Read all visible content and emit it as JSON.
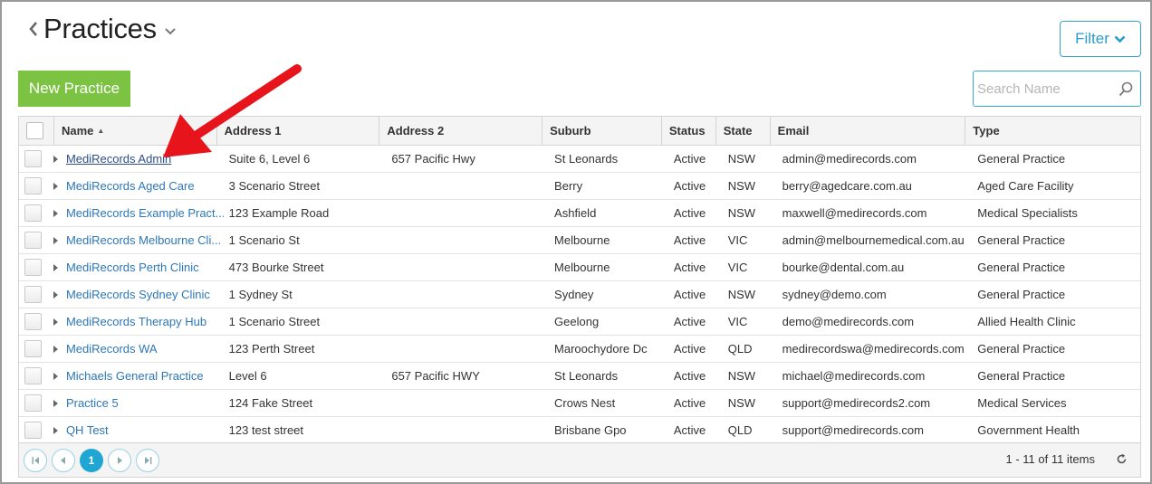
{
  "header": {
    "title": "Practices"
  },
  "toolbar": {
    "filter_label": "Filter",
    "new_practice_label": "New Practice",
    "search_placeholder": "Search Name",
    "search_value": ""
  },
  "grid": {
    "columns": {
      "name": "Name",
      "address1": "Address 1",
      "address2": "Address 2",
      "suburb": "Suburb",
      "status": "Status",
      "state": "State",
      "email": "Email",
      "type": "Type"
    },
    "rows": [
      {
        "name": "MediRecords Admin",
        "address1": "Suite 6, Level 6",
        "address2": "657 Pacific Hwy",
        "suburb": "St Leonards",
        "status": "Active",
        "state": "NSW",
        "email": "admin@medirecords.com",
        "type": "General Practice"
      },
      {
        "name": "MediRecords Aged Care",
        "address1": "3 Scenario Street",
        "address2": "",
        "suburb": "Berry",
        "status": "Active",
        "state": "NSW",
        "email": "berry@agedcare.com.au",
        "type": "Aged Care Facility"
      },
      {
        "name": "MediRecords Example Pract...",
        "address1": "123 Example Road",
        "address2": "",
        "suburb": "Ashfield",
        "status": "Active",
        "state": "NSW",
        "email": "maxwell@medirecords.com",
        "type": "Medical Specialists"
      },
      {
        "name": "MediRecords Melbourne Cli...",
        "address1": "1 Scenario St",
        "address2": "",
        "suburb": "Melbourne",
        "status": "Active",
        "state": "VIC",
        "email": "admin@melbournemedical.com.au",
        "type": "General Practice"
      },
      {
        "name": "MediRecords Perth Clinic",
        "address1": "473 Bourke Street",
        "address2": "",
        "suburb": "Melbourne",
        "status": "Active",
        "state": "VIC",
        "email": "bourke@dental.com.au",
        "type": "General Practice"
      },
      {
        "name": "MediRecords Sydney Clinic",
        "address1": "1 Sydney St",
        "address2": "",
        "suburb": "Sydney",
        "status": "Active",
        "state": "NSW",
        "email": "sydney@demo.com",
        "type": "General Practice"
      },
      {
        "name": "MediRecords Therapy Hub",
        "address1": "1 Scenario Street",
        "address2": "",
        "suburb": "Geelong",
        "status": "Active",
        "state": "VIC",
        "email": "demo@medirecords.com",
        "type": "Allied Health Clinic"
      },
      {
        "name": "MediRecords WA",
        "address1": "123 Perth Street",
        "address2": "",
        "suburb": "Maroochydore Dc",
        "status": "Active",
        "state": "QLD",
        "email": "medirecordswa@medirecords.com",
        "type": "General Practice"
      },
      {
        "name": "Michaels General Practice",
        "address1": "Level 6",
        "address2": "657 Pacific HWY",
        "suburb": "St Leonards",
        "status": "Active",
        "state": "NSW",
        "email": "michael@medirecords.com",
        "type": "General Practice"
      },
      {
        "name": "Practice 5",
        "address1": "124 Fake Street",
        "address2": "",
        "suburb": "Crows Nest",
        "status": "Active",
        "state": "NSW",
        "email": "support@medirecords2.com",
        "type": "Medical Services"
      },
      {
        "name": "QH Test",
        "address1": "123 test street",
        "address2": "",
        "suburb": "Brisbane Gpo",
        "status": "Active",
        "state": "QLD",
        "email": "support@medirecords.com",
        "type": "Government Health"
      }
    ]
  },
  "pager": {
    "current_page": "1",
    "info": "1 - 11 of 11 items"
  },
  "colors": {
    "accent": "#1fa6d3",
    "new_button": "#7cc243",
    "link": "#2d77b8",
    "annotation_arrow": "#e8141b"
  },
  "icons": {
    "back": "chevron-left-icon",
    "title_menu": "chevron-down-icon",
    "filter": "chevron-down-icon",
    "search": "search-icon",
    "row_expand": "triangle-right-icon",
    "refresh": "refresh-icon"
  }
}
